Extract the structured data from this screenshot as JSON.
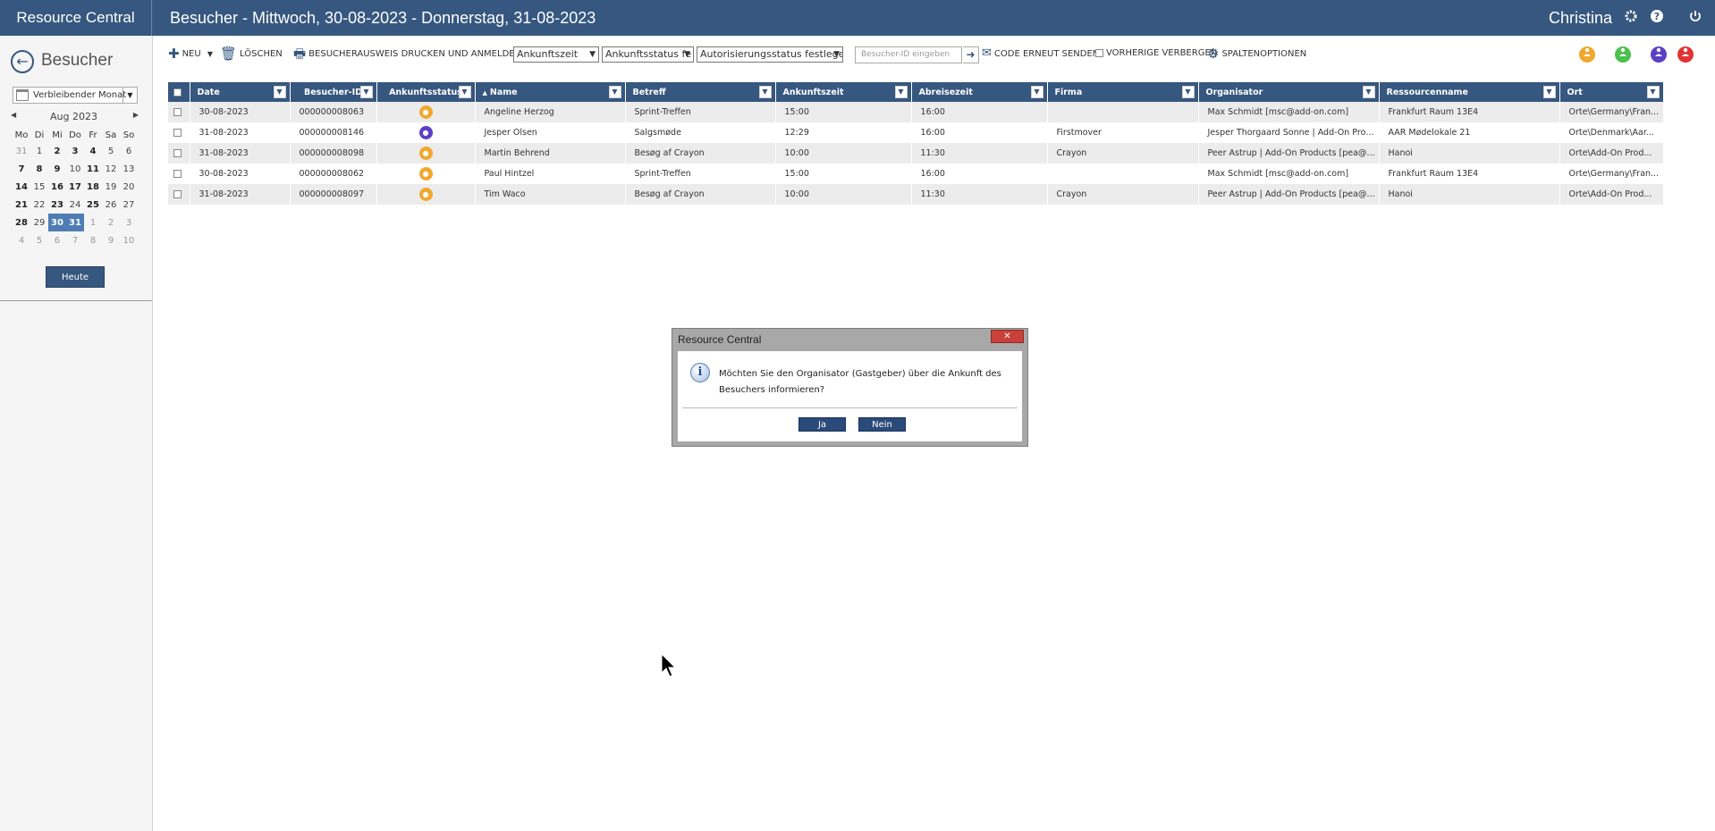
{
  "app": {
    "brand": "Resource Central",
    "page_title": "Besucher - Mittwoch, 30-08-2023 - Donnerstag, 31-08-2023",
    "user": "Christina"
  },
  "sidebar": {
    "title": "Besucher",
    "range_select": "Verbleibender Monat",
    "calendar": {
      "month": "Aug 2023",
      "weekdays": [
        "Mo",
        "Di",
        "Mi",
        "Do",
        "Fr",
        "Sa",
        "So"
      ],
      "weeks": [
        [
          "31",
          "1",
          "2",
          "3",
          "4",
          "5",
          "6"
        ],
        [
          "7",
          "8",
          "9",
          "10",
          "11",
          "12",
          "13"
        ],
        [
          "14",
          "15",
          "16",
          "17",
          "18",
          "19",
          "20"
        ],
        [
          "21",
          "22",
          "23",
          "24",
          "25",
          "26",
          "27"
        ],
        [
          "28",
          "29",
          "30",
          "31",
          "1",
          "2",
          "3"
        ],
        [
          "4",
          "5",
          "6",
          "7",
          "8",
          "9",
          "10"
        ]
      ]
    },
    "today_label": "Heute"
  },
  "toolbar": {
    "new_label": "NEU",
    "delete_label": "LÖSCHEN",
    "print_label": "BESUCHERAUSWEIS DRUCKEN UND ANMELDEN",
    "select_arrival_time": "Ankunftszeit",
    "select_arrival_status": "Ankunftsstatus fe",
    "select_auth_status": "Autorisierungsstatus festlegen",
    "visitor_id_placeholder": "Besucher-ID eingeben",
    "resend_code_label": "CODE ERNEUT SENDEN",
    "hide_previous_label": "VORHERIGE VERBERGEN",
    "column_options_label": "SPALTENOPTIONEN"
  },
  "status_colors": {
    "orange": "#f0a830",
    "green": "#4cc04c",
    "purple": "#5b3fc4",
    "red": "#e03434"
  },
  "table": {
    "columns": [
      "Date",
      "Besucher-ID",
      "Ankunftsstatus",
      "Name",
      "Betreff",
      "Ankunftszeit",
      "Abreisezeit",
      "Firma",
      "Organisator",
      "Ressourcenname",
      "Ort"
    ],
    "rows": [
      {
        "date": "30-08-2023",
        "id": "000000008063",
        "status": "orange",
        "name": "Angeline Herzog",
        "subject": "Sprint-Treffen",
        "arrival": "15:00",
        "departure": "16:00",
        "company": "",
        "organizer": "Max Schmidt [msc@add-on.com]",
        "resource": "Frankfurt Raum 13E4",
        "location": "Orte\\Germany\\Fran..."
      },
      {
        "date": "31-08-2023",
        "id": "000000008146",
        "status": "purple",
        "name": "Jesper Olsen",
        "subject": "Salgsmøde",
        "arrival": "12:29",
        "departure": "16:00",
        "company": "Firstmover",
        "organizer": "Jesper Thorgaard Sonne | Add-On Prod...",
        "resource": "AAR Mødelokale 21",
        "location": "Orte\\Denmark\\Aar..."
      },
      {
        "date": "31-08-2023",
        "id": "000000008098",
        "status": "orange",
        "name": "Martin Behrend",
        "subject": "Besøg af Crayon",
        "arrival": "10:00",
        "departure": "11:30",
        "company": "Crayon",
        "organizer": "Peer Astrup | Add-On Products [pea@a...",
        "resource": "Hanoi",
        "location": "Orte\\Add-On Prod..."
      },
      {
        "date": "30-08-2023",
        "id": "000000008062",
        "status": "orange",
        "name": "Paul Hintzel",
        "subject": "Sprint-Treffen",
        "arrival": "15:00",
        "departure": "16:00",
        "company": "",
        "organizer": "Max Schmidt [msc@add-on.com]",
        "resource": "Frankfurt Raum 13E4",
        "location": "Orte\\Germany\\Fran..."
      },
      {
        "date": "31-08-2023",
        "id": "000000008097",
        "status": "orange",
        "name": "Tim Waco",
        "subject": "Besøg af Crayon",
        "arrival": "10:00",
        "departure": "11:30",
        "company": "Crayon",
        "organizer": "Peer Astrup | Add-On Products [pea@a...",
        "resource": "Hanoi",
        "location": "Orte\\Add-On Prod..."
      }
    ]
  },
  "dialog": {
    "title": "Resource Central",
    "close_glyph": "✕",
    "message": "Möchten Sie den Organisator (Gastgeber) über die Ankunft des Besuchers informieren?",
    "yes_label": "Ja",
    "no_label": "Nein"
  }
}
